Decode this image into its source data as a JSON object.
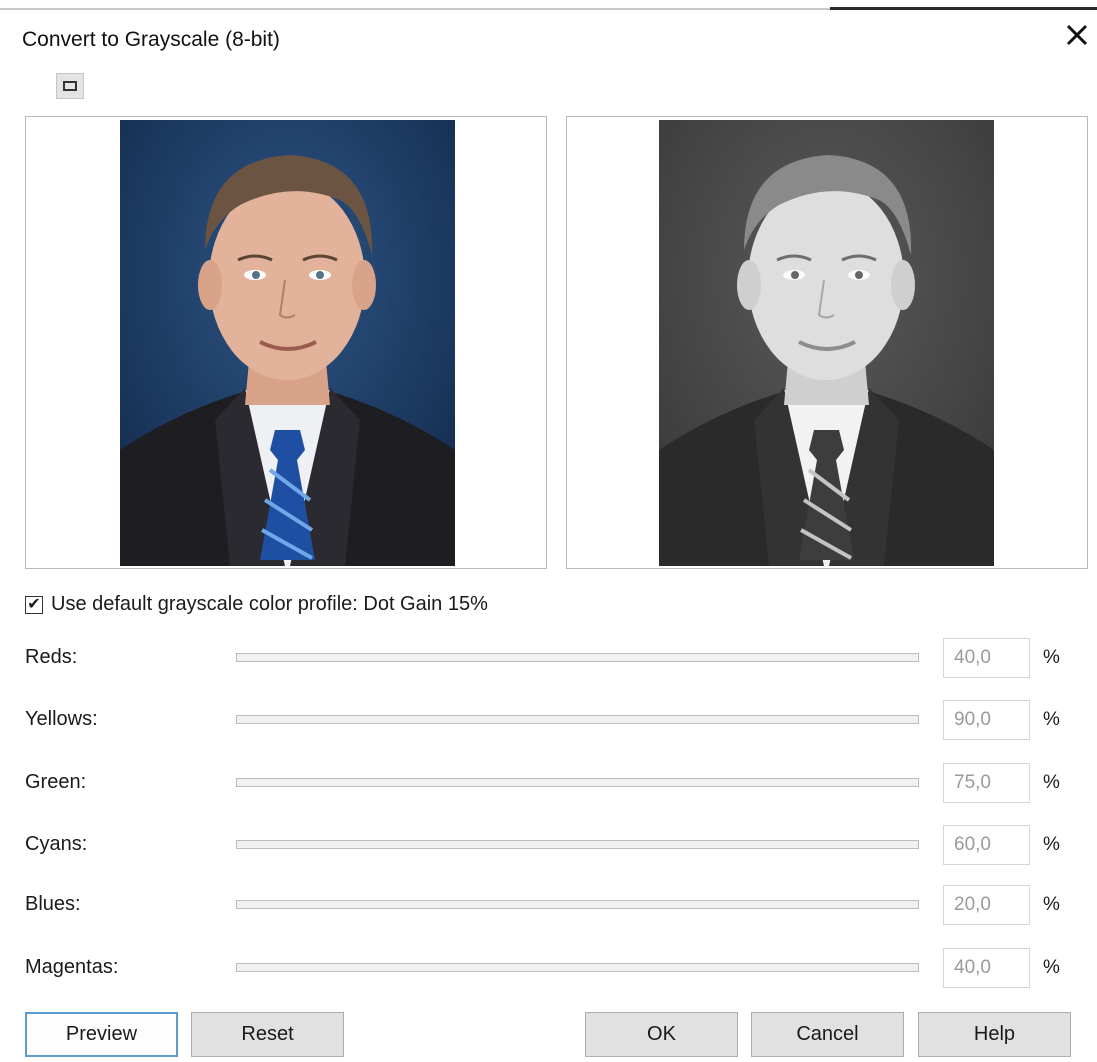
{
  "dialog": {
    "title": "Convert to Grayscale (8-bit)"
  },
  "icons": {
    "close": "close-icon",
    "view_toggle": "single-view-icon",
    "checkbox_mark": "✔"
  },
  "profile_option": {
    "checked": true,
    "label": "Use default grayscale color profile: Dot Gain 15%"
  },
  "sliders": [
    {
      "label": "Reds:",
      "value": "40,0",
      "unit": "%",
      "percent": 40
    },
    {
      "label": "Yellows:",
      "value": "90,0",
      "unit": "%",
      "percent": 90
    },
    {
      "label": "Green:",
      "value": "75,0",
      "unit": "%",
      "percent": 75
    },
    {
      "label": "Cyans:",
      "value": "60,0",
      "unit": "%",
      "percent": 60
    },
    {
      "label": "Blues:",
      "value": "20,0",
      "unit": "%",
      "percent": 20
    },
    {
      "label": "Magentas:",
      "value": "40,0",
      "unit": "%",
      "percent": 40
    }
  ],
  "buttons": {
    "preview": "Preview",
    "reset": "Reset",
    "ok": "OK",
    "cancel": "Cancel",
    "help": "Help"
  },
  "colors": {
    "focus_border": "#5b9bd5",
    "original_background": "#1e3d66",
    "grayscale_background": "#4a4a4a"
  }
}
